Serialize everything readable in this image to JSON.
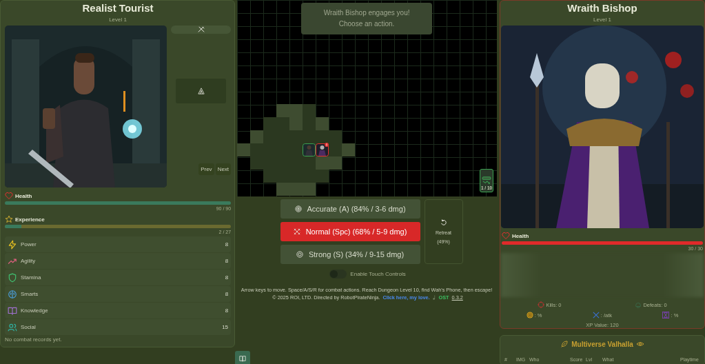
{
  "player": {
    "name": "Realist Tourist",
    "level": "Level 1",
    "gallery": {
      "prev": "Prev",
      "next": "Next"
    },
    "health": {
      "label": "Health",
      "level": 1,
      "reading": "90 / 90"
    },
    "experience": {
      "label": "Experience",
      "level": 0.074,
      "reading": "2 / 27"
    },
    "stats": [
      {
        "kind": "power",
        "label": "Power",
        "value": "8"
      },
      {
        "kind": "agility",
        "label": "Agility",
        "value": "8"
      },
      {
        "kind": "stamina",
        "label": "Stamina",
        "value": "8"
      },
      {
        "kind": "smarts",
        "label": "Smarts",
        "value": "8"
      },
      {
        "kind": "knowledge",
        "label": "Knowledge",
        "value": "8"
      },
      {
        "kind": "social",
        "label": "Social",
        "value": "15"
      }
    ],
    "records_note": "No combat records yet."
  },
  "map": {
    "message": [
      "Wraith Bishop engages you!",
      "Choose an action."
    ],
    "floor_counter": "1 / 10"
  },
  "actions": [
    {
      "kind": "accurate",
      "label": "Accurate (A) (84% / 3-6 dmg)",
      "selected": false
    },
    {
      "kind": "normal",
      "label": "Normal (Spc) (68% / 5-9 dmg)",
      "selected": true
    },
    {
      "kind": "strong",
      "label": "Strong (S) (34% / 9-15 dmg)",
      "selected": false
    }
  ],
  "retreat": {
    "label": "Retreat",
    "chance": "(49%)"
  },
  "touch_controls": {
    "label": "Enable Touch Controls",
    "on": false
  },
  "footer": {
    "instructions": "Arrow keys to move. Space/A/S/R for combat actions. Reach Dungeon Level 10, find Wah's Phone, then escape!",
    "copyright": "© 2025 ROI, LTD. Directed by RobotPirateNinja.",
    "link": "Click here, my love.",
    "ost": "OST",
    "version": "0.3.2"
  },
  "enemy": {
    "name": "Wraith Bishop",
    "level": "Level 1",
    "health": {
      "label": "Health",
      "level": 1,
      "reading": "30 / 30"
    },
    "kills": "Kills: 0",
    "defeats": "Defeats: 0",
    "stats": [
      {
        "kind": "accuracy",
        "text": ": %"
      },
      {
        "kind": "attack",
        "text": ": /atk"
      },
      {
        "kind": "defense",
        "text": ": %"
      }
    ],
    "xp_value": "XP Value: 120"
  },
  "leaderboard": {
    "title": "Multiverse Valhalla",
    "columns": [
      "#",
      "IMG",
      "Who",
      "Score",
      "Lvl",
      "What",
      "Playtime"
    ]
  }
}
